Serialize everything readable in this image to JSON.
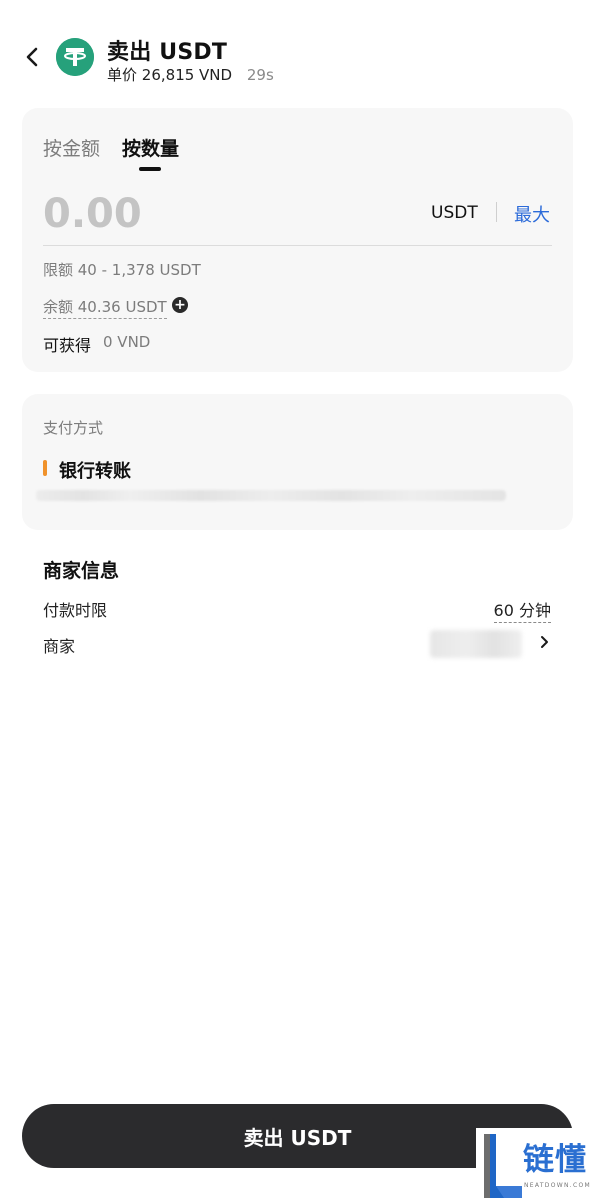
{
  "header": {
    "title": "卖出 USDT",
    "price_prefix": "单价",
    "price": "26,815 VND",
    "countdown": "29s"
  },
  "amount_card": {
    "tabs": [
      {
        "label": "按金额",
        "active": false
      },
      {
        "label": "按数量",
        "active": true
      }
    ],
    "amount_placeholder": "0.00",
    "unit": "USDT",
    "max_label": "最大",
    "limit_text": "限额 40 - 1,378 USDT",
    "balance_text": "余额 40.36 USDT",
    "receive_label": "可获得",
    "receive_value": "0 VND"
  },
  "payment": {
    "title": "支付方式",
    "method": "银行转账"
  },
  "merchant_info": {
    "title": "商家信息",
    "pay_limit_label": "付款时限",
    "pay_limit_value": "60 分钟",
    "merchant_label": "商家"
  },
  "sell_button": "卖出 USDT",
  "watermark": {
    "cn": "链懂",
    "en": "NEATDOWN.COM"
  },
  "colors": {
    "tether_green": "#26a17b",
    "accent_blue": "#2c6bd9",
    "payment_orange": "#f0922b",
    "button_dark": "#2b2b2d"
  }
}
